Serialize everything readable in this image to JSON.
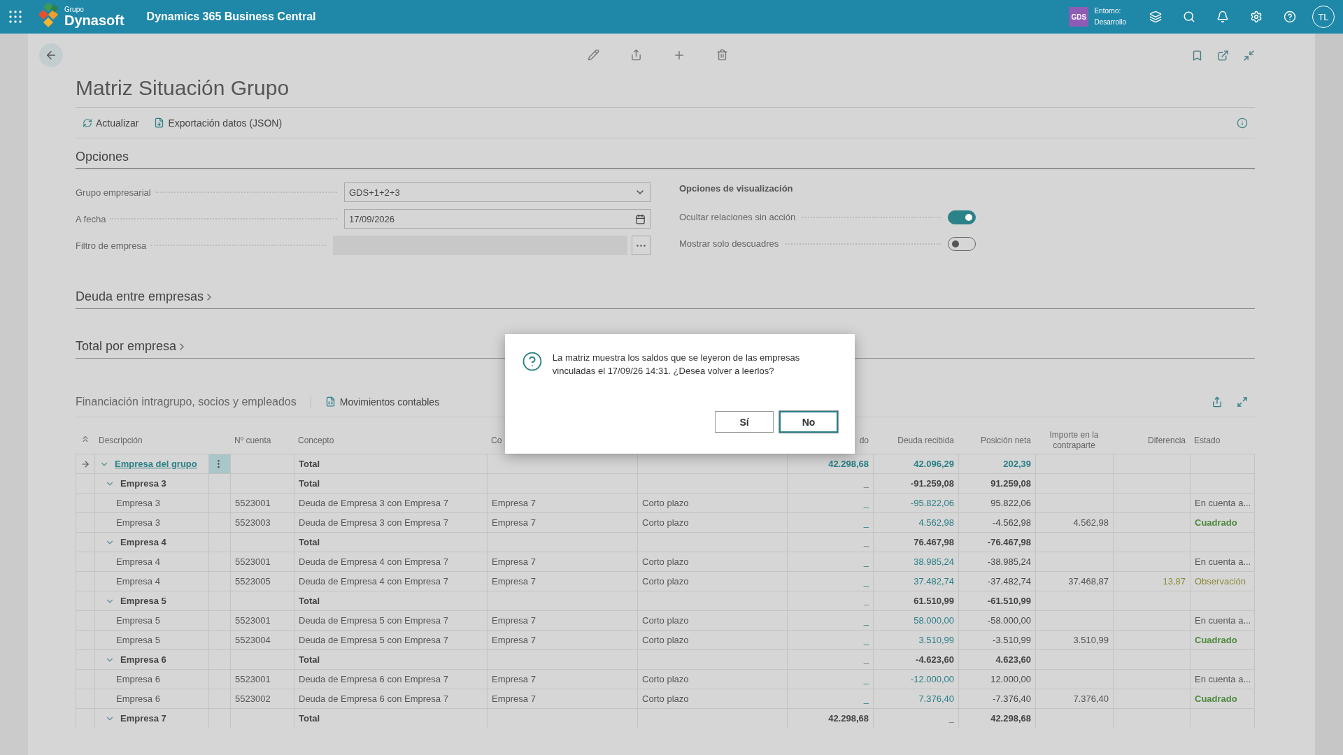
{
  "topbar": {
    "logo_small": "Grupo",
    "logo": "Dynasoft",
    "app_title": "Dynamics 365 Business Central",
    "env_badge": "GDS",
    "env_label": "Entorno:",
    "env_value": "Desarrollo",
    "avatar": "TL"
  },
  "page": {
    "title": "Matriz Situación Grupo",
    "actions": [
      "Actualizar",
      "Exportación datos (JSON)"
    ]
  },
  "options": {
    "title": "Opciones",
    "fields": [
      {
        "label": "Grupo empresarial",
        "kind": "select",
        "value": "GDS+1+2+3"
      },
      {
        "label": "A fecha",
        "kind": "date",
        "value": "17/09/2026"
      },
      {
        "label": "Filtro de empresa",
        "kind": "lookup"
      }
    ],
    "display_title": "Opciones de visualización",
    "toggles": [
      {
        "label": "Ocultar relaciones sin acción",
        "on": true
      },
      {
        "label": "Mostrar solo descuadres",
        "on": false
      }
    ]
  },
  "sections": [
    {
      "title": "Deuda entre empresas"
    },
    {
      "title": "Total por empresa"
    }
  ],
  "part": {
    "title": "Financiación intragrupo, socios y empleados",
    "action": "Movimientos contables"
  },
  "table": {
    "columns": [
      "Descripción",
      "Nº cuenta",
      "Concepto",
      "Co",
      "",
      "do",
      "Deuda recibida",
      "Posición neta",
      "Importe en la contraparte",
      "Diferencia",
      "Estado"
    ],
    "rows": [
      {
        "kind": "root",
        "selected": true,
        "expanded": true,
        "desc": "Empresa del grupo",
        "cuenta": "",
        "concepto": "Total",
        "co": "",
        "plazo": "",
        "saldo": "42.298,68",
        "recibida": "42.096,29",
        "neta": "202,39",
        "importe": "",
        "diferencia": "",
        "estado": null
      },
      {
        "kind": "group",
        "selected": false,
        "expanded": true,
        "desc": "Empresa 3",
        "cuenta": "",
        "concepto": "Total",
        "co": "",
        "plazo": "",
        "saldo": "_",
        "recibida": "-91.259,08",
        "neta": "91.259,08",
        "importe": "",
        "diferencia": "",
        "estado": null
      },
      {
        "kind": "detail",
        "selected": false,
        "desc": "Empresa 3",
        "cuenta": "5523001",
        "concepto": "Deuda de Empresa 3 con Empresa 7",
        "co": "Empresa 7",
        "plazo": "Corto plazo",
        "saldo": "_",
        "recibida": "-95.822,06",
        "neta": "95.822,06",
        "importe": "",
        "diferencia": "",
        "estado": {
          "text": "En cuenta a...",
          "kind": "pending"
        }
      },
      {
        "kind": "detail",
        "selected": false,
        "desc": "Empresa 3",
        "cuenta": "5523003",
        "concepto": "Deuda de Empresa 3 con Empresa 7",
        "co": "Empresa 7",
        "plazo": "Corto plazo",
        "saldo": "_",
        "recibida": "4.562,98",
        "neta": "-4.562,98",
        "importe": "4.562,98",
        "diferencia": "",
        "estado": {
          "text": "Cuadrado",
          "kind": "balanced"
        }
      },
      {
        "kind": "group",
        "selected": false,
        "expanded": true,
        "desc": "Empresa 4",
        "cuenta": "",
        "concepto": "Total",
        "co": "",
        "plazo": "",
        "saldo": "_",
        "recibida": "76.467,98",
        "neta": "-76.467,98",
        "importe": "",
        "diferencia": "",
        "estado": null
      },
      {
        "kind": "detail",
        "selected": false,
        "desc": "Empresa 4",
        "cuenta": "5523001",
        "concepto": "Deuda de Empresa 4 con Empresa 7",
        "co": "Empresa 7",
        "plazo": "Corto plazo",
        "saldo": "_",
        "recibida": "38.985,24",
        "neta": "-38.985,24",
        "importe": "",
        "diferencia": "",
        "estado": {
          "text": "En cuenta a...",
          "kind": "pending"
        }
      },
      {
        "kind": "detail",
        "selected": false,
        "desc": "Empresa 4",
        "cuenta": "5523005",
        "concepto": "Deuda de Empresa 4 con Empresa 7",
        "co": "Empresa 7",
        "plazo": "Corto plazo",
        "saldo": "_",
        "recibida": "37.482,74",
        "neta": "-37.482,74",
        "importe": "37.468,87",
        "diferencia": "13,87",
        "estado": {
          "text": "Observación",
          "kind": "observation"
        }
      },
      {
        "kind": "group",
        "selected": false,
        "expanded": true,
        "desc": "Empresa 5",
        "cuenta": "",
        "concepto": "Total",
        "co": "",
        "plazo": "",
        "saldo": "_",
        "recibida": "61.510,99",
        "neta": "-61.510,99",
        "importe": "",
        "diferencia": "",
        "estado": null
      },
      {
        "kind": "detail",
        "selected": false,
        "desc": "Empresa 5",
        "cuenta": "5523001",
        "concepto": "Deuda de Empresa 5 con Empresa 7",
        "co": "Empresa 7",
        "plazo": "Corto plazo",
        "saldo": "_",
        "recibida": "58.000,00",
        "neta": "-58.000,00",
        "importe": "",
        "diferencia": "",
        "estado": {
          "text": "En cuenta a...",
          "kind": "pending"
        }
      },
      {
        "kind": "detail",
        "selected": false,
        "desc": "Empresa 5",
        "cuenta": "5523004",
        "concepto": "Deuda de Empresa 5 con Empresa 7",
        "co": "Empresa 7",
        "plazo": "Corto plazo",
        "saldo": "_",
        "recibida": "3.510,99",
        "neta": "-3.510,99",
        "importe": "3.510,99",
        "diferencia": "",
        "estado": {
          "text": "Cuadrado",
          "kind": "balanced"
        }
      },
      {
        "kind": "group",
        "selected": false,
        "expanded": true,
        "desc": "Empresa 6",
        "cuenta": "",
        "concepto": "Total",
        "co": "",
        "plazo": "",
        "saldo": "_",
        "recibida": "-4.623,60",
        "neta": "4.623,60",
        "importe": "",
        "diferencia": "",
        "estado": null
      },
      {
        "kind": "detail",
        "selected": false,
        "desc": "Empresa 6",
        "cuenta": "5523001",
        "concepto": "Deuda de Empresa 6 con Empresa 7",
        "co": "Empresa 7",
        "plazo": "Corto plazo",
        "saldo": "_",
        "recibida": "-12.000,00",
        "neta": "12.000,00",
        "importe": "",
        "diferencia": "",
        "estado": {
          "text": "En cuenta a...",
          "kind": "pending"
        }
      },
      {
        "kind": "detail",
        "selected": false,
        "desc": "Empresa 6",
        "cuenta": "5523002",
        "concepto": "Deuda de Empresa 6 con Empresa 7",
        "co": "Empresa 7",
        "plazo": "Corto plazo",
        "saldo": "_",
        "recibida": "7.376,40",
        "neta": "-7.376,40",
        "importe": "7.376,40",
        "diferencia": "",
        "estado": {
          "text": "Cuadrado",
          "kind": "balanced"
        }
      },
      {
        "kind": "group",
        "selected": false,
        "expanded": true,
        "desc": "Empresa 7",
        "cuenta": "",
        "concepto": "Total",
        "co": "",
        "plazo": "",
        "saldo": "42.298,68",
        "recibida": "_",
        "neta": "42.298,68",
        "importe": "",
        "diferencia": "",
        "estado": null
      }
    ]
  },
  "dialog": {
    "message": "La matriz muestra los saldos que se leyeron de las empresas vinculadas el 17/09/26 14:31. ¿Desea volver a leerlos?",
    "buttons": [
      {
        "label": "Sí",
        "focused": false
      },
      {
        "label": "No",
        "focused": true
      }
    ]
  }
}
